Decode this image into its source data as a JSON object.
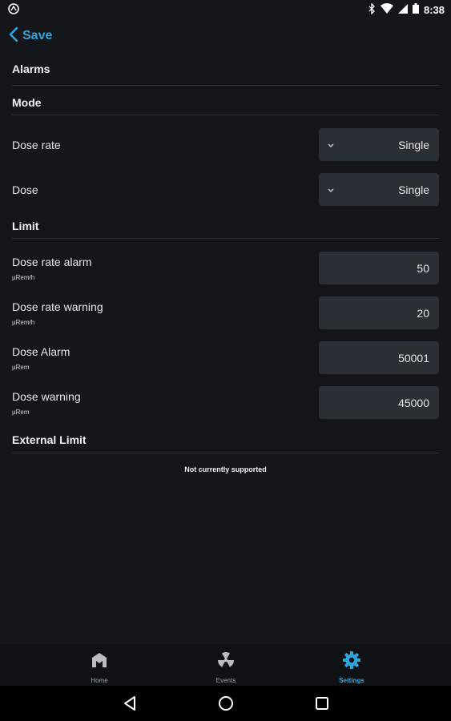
{
  "status_bar": {
    "time": "8:38",
    "icons": [
      "app-notification-icon",
      "bluetooth-icon",
      "wifi-icon",
      "sim-icon",
      "battery-icon"
    ]
  },
  "header": {
    "back_label": "Save"
  },
  "sections": {
    "alarms": "Alarms",
    "mode": "Mode",
    "limit": "Limit",
    "external_limit": "External Limit"
  },
  "mode_rows": [
    {
      "label": "Dose rate",
      "value": "Single"
    },
    {
      "label": "Dose",
      "value": "Single"
    }
  ],
  "limit_rows": [
    {
      "label": "Dose rate alarm",
      "unit": "µRem/h",
      "value": "50"
    },
    {
      "label": "Dose rate warning",
      "unit": "µRem/h",
      "value": "20"
    },
    {
      "label": "Dose Alarm",
      "unit": "µRem",
      "value": "50001"
    },
    {
      "label": "Dose warning",
      "unit": "µRem",
      "value": "45000"
    }
  ],
  "external_note": "Not currently supported",
  "bottom_nav": [
    {
      "label": "Home",
      "icon": "home-icon",
      "active": false
    },
    {
      "label": "Events",
      "icon": "radiation-icon",
      "active": false
    },
    {
      "label": "Settings",
      "icon": "gear-icon",
      "active": true
    }
  ],
  "colors": {
    "accent": "#2ea7e0",
    "background": "#14161a",
    "field": "#2a2e35"
  }
}
